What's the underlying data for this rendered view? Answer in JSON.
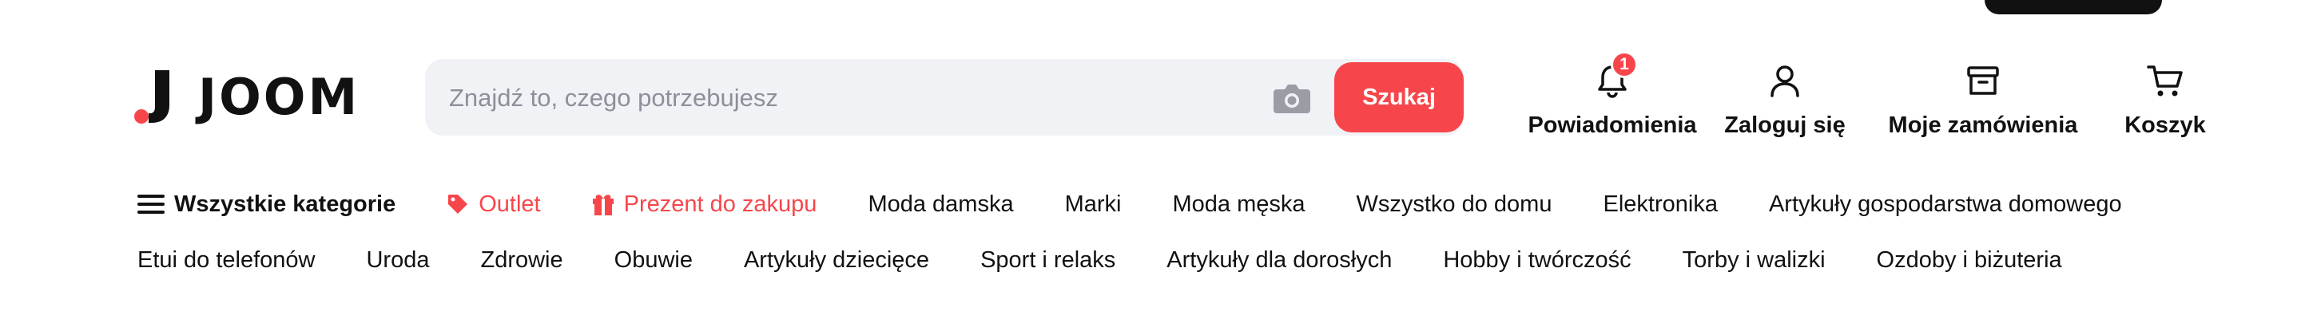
{
  "brand": {
    "name": "JOOM",
    "accent": "#f7464b"
  },
  "search": {
    "placeholder": "Znajdź to, czego potrzebujesz",
    "button_label": "Szukaj"
  },
  "actions": {
    "notifications": {
      "label": "Powiadomienia",
      "badge": "1"
    },
    "login": {
      "label": "Zaloguj się"
    },
    "orders": {
      "label": "Moje zamówienia"
    },
    "cart": {
      "label": "Koszyk"
    }
  },
  "nav": {
    "row1": [
      {
        "label": "Wszystkie kategorie",
        "icon": "menu-icon"
      },
      {
        "label": "Outlet",
        "icon": "tag-icon"
      },
      {
        "label": "Prezent do zakupu",
        "icon": "gift-icon"
      },
      {
        "label": "Moda damska"
      },
      {
        "label": "Marki"
      },
      {
        "label": "Moda męska"
      },
      {
        "label": "Wszystko do domu"
      },
      {
        "label": "Elektronika"
      },
      {
        "label": "Artykuły gospodarstwa domowego"
      }
    ],
    "row2": [
      {
        "label": "Etui do telefonów"
      },
      {
        "label": "Uroda"
      },
      {
        "label": "Zdrowie"
      },
      {
        "label": "Obuwie"
      },
      {
        "label": "Artykuły dziecięce"
      },
      {
        "label": "Sport i relaks"
      },
      {
        "label": "Artykuły dla dorosłych"
      },
      {
        "label": "Hobby i twórczość"
      },
      {
        "label": "Torby i walizki"
      },
      {
        "label": "Ozdoby i biżuteria"
      }
    ]
  }
}
